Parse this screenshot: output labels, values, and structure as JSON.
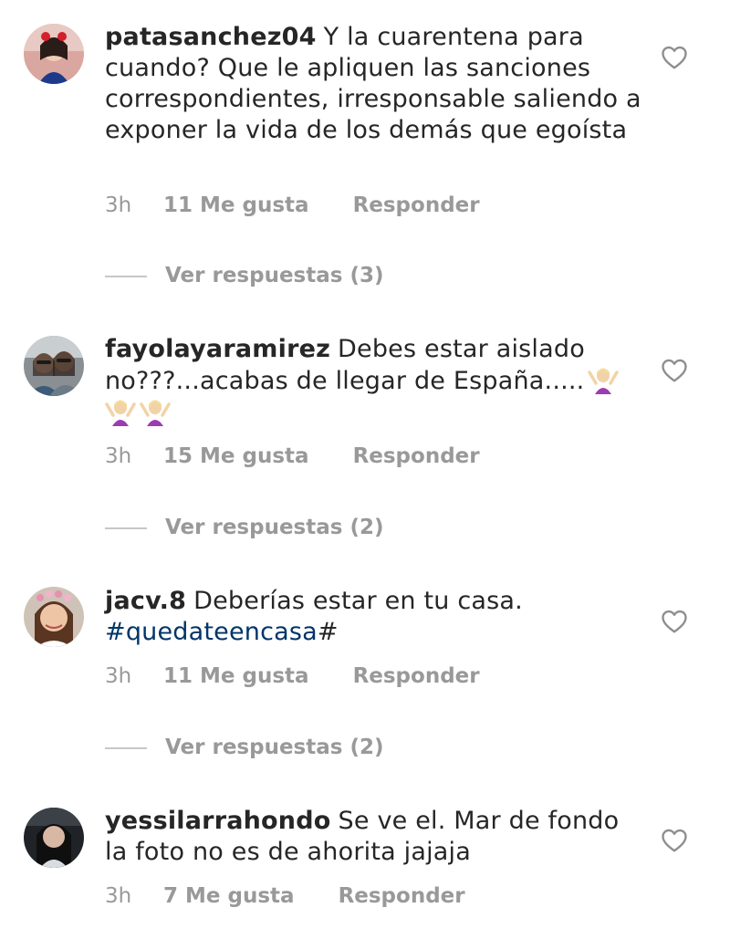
{
  "comments": [
    {
      "username": "patasanchez04",
      "text": "Y la cuarentena para cuando? Que le apliquen las sanciones correspondientes, irresponsable saliendo a exponer la vida de los demás que egoísta",
      "time": "3h",
      "likes": "11 Me gusta",
      "reply_label": "Responder",
      "view_replies": "Ver respuestas (3)"
    },
    {
      "username": "fayolayaramirez",
      "text": "Debes estar aislado no???...acabas de llegar de España.....",
      "emoji_count": 3,
      "emoji_icon": "person-shrugging-emoji",
      "time": "3h",
      "likes": "15 Me gusta",
      "reply_label": "Responder",
      "view_replies": "Ver respuestas (2)"
    },
    {
      "username": "jacv.8",
      "text": "Deberías estar en tu casa.",
      "hashtag": "#quedateencasa",
      "trailing": "#",
      "time": "3h",
      "likes": "11 Me gusta",
      "reply_label": "Responder",
      "view_replies": "Ver respuestas (2)"
    },
    {
      "username": "yessilarrahondo",
      "text": "Se ve el. Mar de fondo la foto no es de ahorita jajaja",
      "time": "3h",
      "likes": "7 Me gusta",
      "reply_label": "Responder"
    }
  ],
  "icons": {
    "like": "heart-outline-icon",
    "avatar": "avatar"
  },
  "colors": {
    "text": "#262626",
    "meta": "#999999",
    "hashtag": "#003569",
    "divider": "#c7c7c7"
  }
}
